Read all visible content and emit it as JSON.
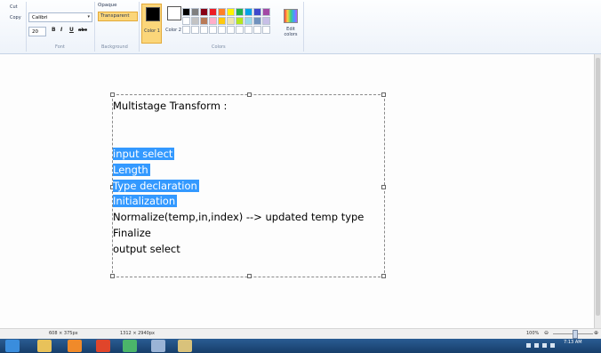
{
  "ribbon": {
    "clipboard": {
      "cut": "Cut",
      "copy": "Copy"
    },
    "font": {
      "name": "Calibri",
      "size": "20",
      "bold": "B",
      "italic": "I",
      "underline": "U",
      "strike": "abc",
      "group_label": "Font"
    },
    "background": {
      "opaque": "Opaque",
      "transparent": "Transparent",
      "group_label": "Background"
    },
    "colors": {
      "color1_label": "Color 1",
      "color2_label": "Color 2",
      "edit_label": "Edit colors",
      "group_label": "Colors",
      "color1": "#000000",
      "color2": "#ffffff",
      "palette": [
        "#000000",
        "#7f7f7f",
        "#880015",
        "#ed1c24",
        "#ff7f27",
        "#fff200",
        "#22b14c",
        "#00a2e8",
        "#3f48cc",
        "#a349a4",
        "#ffffff",
        "#c3c3c3",
        "#b97a57",
        "#ffaec9",
        "#ffc90e",
        "#efe4b0",
        "#b5e61d",
        "#99d9ea",
        "#7092be",
        "#c8bfe7",
        "#ffffff",
        "#ffffff",
        "#ffffff",
        "#ffffff",
        "#ffffff",
        "#ffffff",
        "#ffffff",
        "#ffffff",
        "#ffffff",
        "#ffffff"
      ]
    }
  },
  "canvas": {
    "lines": [
      {
        "text": "Multistage Transform :",
        "highlight": false
      },
      {
        "text": "",
        "highlight": false
      },
      {
        "text": "",
        "highlight": false
      },
      {
        "text": "input select",
        "highlight": true
      },
      {
        "text": "Length",
        "highlight": true
      },
      {
        "text": "Type declaration",
        "highlight": true
      },
      {
        "text": "Initialization",
        "highlight": true
      },
      {
        "text": "Normalize(temp,in,index) --> updated temp type",
        "highlight": false
      },
      {
        "text": "Finalize",
        "highlight": false
      },
      {
        "text": "output select",
        "highlight": false
      }
    ]
  },
  "status": {
    "selection_size": "608 × 375px",
    "image_size": "1312 × 2940px",
    "zoom": "100%"
  },
  "taskbar": {
    "time": "7:13 AM"
  }
}
